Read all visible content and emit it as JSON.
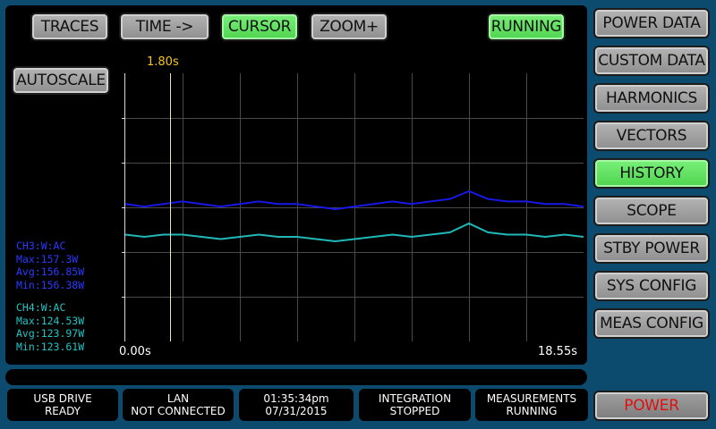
{
  "toolbar": {
    "traces": "TRACES",
    "time": "TIME ->",
    "cursor": "CURSOR",
    "zoom": "ZOOM+",
    "running": "RUNNING",
    "autoscale": "AUTOSCALE"
  },
  "chart": {
    "cursor_label": "1.80s",
    "x_start_label": "0.00s",
    "x_end_label": "18.55s"
  },
  "chart_data": {
    "type": "line",
    "xlim": [
      0,
      18.55
    ],
    "cursor_x": 1.8,
    "grid": true,
    "series": [
      {
        "name": "CH3:W:AC",
        "color": "#1818e6",
        "values": [
          156.8,
          156.7,
          156.8,
          156.9,
          156.8,
          156.7,
          156.8,
          156.9,
          156.8,
          156.8,
          156.7,
          156.6,
          156.7,
          156.8,
          156.9,
          156.8,
          156.9,
          157.0,
          157.3,
          157.0,
          156.9,
          156.9,
          156.8,
          156.8,
          156.7
        ]
      },
      {
        "name": "CH4:W:AC",
        "color": "#20b8b8",
        "values": [
          124.0,
          123.9,
          124.0,
          124.0,
          123.9,
          123.8,
          123.9,
          124.0,
          123.9,
          123.9,
          123.8,
          123.7,
          123.8,
          123.9,
          124.0,
          123.9,
          124.0,
          124.1,
          124.5,
          124.1,
          124.0,
          124.0,
          123.9,
          124.0,
          123.9
        ]
      }
    ]
  },
  "stats": {
    "ch3": {
      "title": "CH3:W:AC",
      "max": "Max:157.3W",
      "avg": "Avg:156.85W",
      "min": "Min:156.38W"
    },
    "ch4": {
      "title": "CH4:W:AC",
      "max": "Max:124.53W",
      "avg": "Avg:123.97W",
      "min": "Min:123.61W"
    }
  },
  "sidebar": {
    "power_data": "POWER DATA",
    "custom_data": "CUSTOM DATA",
    "harmonics": "HARMONICS",
    "vectors": "VECTORS",
    "history": "HISTORY",
    "scope": "SCOPE",
    "stby_power": "STBY POWER",
    "sys_config": "SYS CONFIG",
    "meas_config": "MEAS CONFIG",
    "power": "POWER"
  },
  "status": {
    "usb": {
      "line1": "USB DRIVE",
      "line2": "READY"
    },
    "lan": {
      "line1": "LAN",
      "line2": "NOT CONNECTED"
    },
    "clock": {
      "line1": "01:35:34pm",
      "line2": "07/31/2015"
    },
    "integration": {
      "line1": "INTEGRATION",
      "line2": "STOPPED"
    },
    "measurements": {
      "line1": "MEASUREMENTS",
      "line2": "RUNNING"
    }
  },
  "colors": {
    "background": "#0c4a6e",
    "active_button": "#5fe05f",
    "ch3": "#1818e6",
    "ch4": "#20b8b8",
    "cursor_label": "#f5c518",
    "power_text": "#e01010"
  }
}
